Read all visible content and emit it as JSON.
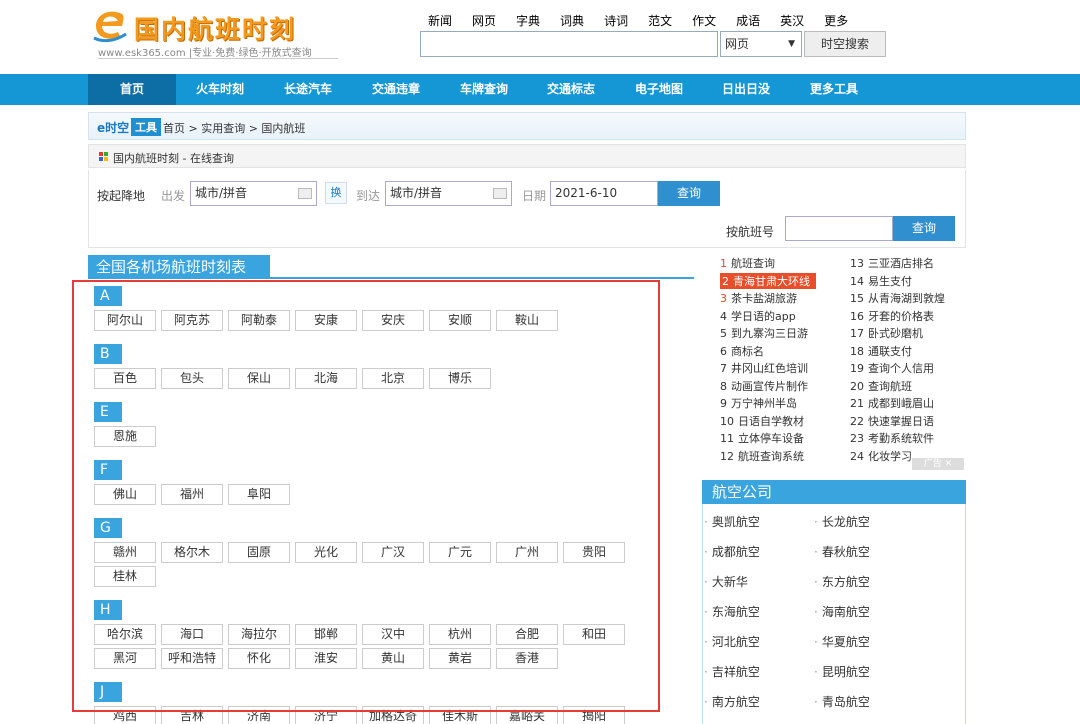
{
  "header": {
    "logo_title": "国内航班时刻",
    "logo_sub": "www.esk365.com |专业·免费·绿色·开放式查询",
    "top_links": [
      "新闻",
      "网页",
      "字典",
      "词典",
      "诗词",
      "范文",
      "作文",
      "成语",
      "英汉",
      "更多"
    ],
    "search_value": "",
    "search_select": "网页",
    "search_button": "时空搜索"
  },
  "nav": [
    "首页",
    "火车时刻",
    "长途汽车",
    "交通违章",
    "车牌查询",
    "交通标志",
    "电子地图",
    "日出日没",
    "更多工具"
  ],
  "breadcrumb": {
    "brand": "e时空",
    "tool": "工具",
    "path": "首页 > 实用查询 > 国内航班"
  },
  "subbar": "国内航班时刻 - 在线查询",
  "query": {
    "by_city_label": "按起降地",
    "from_label": "出发",
    "from_value": "城市/拼音",
    "swap_label": "换",
    "to_label": "到达",
    "to_value": "城市/拼音",
    "date_label": "日期",
    "date_value": "2021-6-10",
    "query_button": "查询",
    "by_flight_label": "按航班号",
    "flight_value": "",
    "flight_button": "查询"
  },
  "section_title": "全国各机场航班时刻表",
  "groups": [
    {
      "letter": "A",
      "cities": [
        "阿尔山",
        "阿克苏",
        "阿勒泰",
        "安康",
        "安庆",
        "安顺",
        "鞍山"
      ]
    },
    {
      "letter": "B",
      "cities": [
        "百色",
        "包头",
        "保山",
        "北海",
        "北京",
        "博乐"
      ]
    },
    {
      "letter": "E",
      "cities": [
        "恩施"
      ]
    },
    {
      "letter": "F",
      "cities": [
        "佛山",
        "福州",
        "阜阳"
      ]
    },
    {
      "letter": "G",
      "cities": [
        "赣州",
        "格尔木",
        "固原",
        "光化",
        "广汉",
        "广元",
        "广州",
        "贵阳",
        "桂林"
      ]
    },
    {
      "letter": "H",
      "cities": [
        "哈尔滨",
        "海口",
        "海拉尔",
        "邯郸",
        "汉中",
        "杭州",
        "合肥",
        "和田",
        "黑河",
        "呼和浩特",
        "怀化",
        "淮安",
        "黄山",
        "黄岩",
        "香港"
      ]
    },
    {
      "letter": "J",
      "cities": [
        "鸡西",
        "吉林",
        "济南",
        "济宁",
        "加格达奇",
        "佳木斯",
        "嘉峪关",
        "揭阳"
      ]
    }
  ],
  "ranking": [
    {
      "n": "1",
      "text": "航班查询"
    },
    {
      "n": "2",
      "text": "青海甘肃大环线"
    },
    {
      "n": "3",
      "text": "茶卡盐湖旅游"
    },
    {
      "n": "4",
      "text": "学日语的app"
    },
    {
      "n": "5",
      "text": "到九寨沟三日游"
    },
    {
      "n": "6",
      "text": "商标名"
    },
    {
      "n": "7",
      "text": "井冈山红色培训"
    },
    {
      "n": "8",
      "text": "动画宣传片制作"
    },
    {
      "n": "9",
      "text": "万宁神州半岛"
    },
    {
      "n": "10",
      "text": "日语自学教材"
    },
    {
      "n": "11",
      "text": "立体停车设备"
    },
    {
      "n": "12",
      "text": "航班查询系统"
    },
    {
      "n": "13",
      "text": "三亚酒店排名"
    },
    {
      "n": "14",
      "text": "易生支付"
    },
    {
      "n": "15",
      "text": "从青海湖到敦煌"
    },
    {
      "n": "16",
      "text": "牙套的价格表"
    },
    {
      "n": "17",
      "text": "卧式砂磨机"
    },
    {
      "n": "18",
      "text": "通联支付"
    },
    {
      "n": "19",
      "text": "查询个人信用"
    },
    {
      "n": "20",
      "text": "查询航班"
    },
    {
      "n": "21",
      "text": "成都到峨眉山"
    },
    {
      "n": "22",
      "text": "快速掌握日语"
    },
    {
      "n": "23",
      "text": "考勤系统软件"
    },
    {
      "n": "24",
      "text": "化妆学习"
    }
  ],
  "ad_tag": "广告",
  "airlines_title": "航空公司",
  "airlines": [
    "奥凯航空",
    "长龙航空",
    "成都航空",
    "春秋航空",
    "大新华",
    "东方航空",
    "东海航空",
    "海南航空",
    "河北航空",
    "华夏航空",
    "吉祥航空",
    "昆明航空",
    "南方航空",
    "青岛航空"
  ],
  "colors": {
    "nav": "#1596d5",
    "accent": "#3aa4de",
    "highlight": "#e53b3b",
    "logo": "#f39a1e"
  }
}
